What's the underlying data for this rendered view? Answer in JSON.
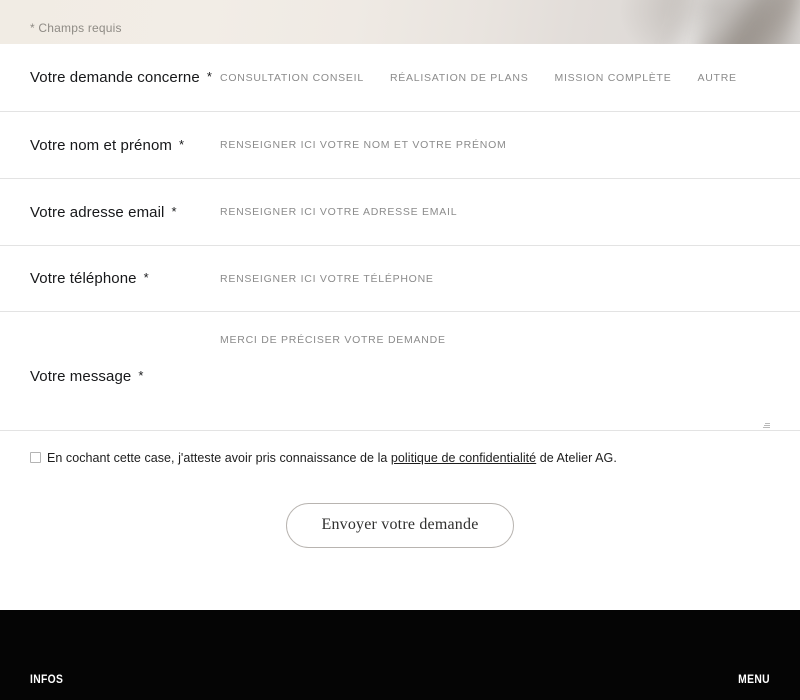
{
  "header": {
    "required_note": "* Champs requis"
  },
  "form": {
    "rows": [
      {
        "label": "Votre demande concerne",
        "required_mark": "*",
        "type": "options",
        "options": [
          "CONSULTATION CONSEIL",
          "RÉALISATION DE PLANS",
          "MISSION COMPLÈTE",
          "AUTRE"
        ]
      },
      {
        "label": "Votre nom et prénom",
        "required_mark": "*",
        "type": "text",
        "placeholder": "RENSEIGNER ICI VOTRE NOM ET VOTRE PRÉNOM",
        "value": ""
      },
      {
        "label": "Votre adresse email",
        "required_mark": "*",
        "type": "email",
        "placeholder": "RENSEIGNER ICI VOTRE ADRESSE EMAIL",
        "value": ""
      },
      {
        "label": "Votre téléphone",
        "required_mark": "*",
        "type": "tel",
        "placeholder": "RENSEIGNER ICI VOTRE TÉLÉPHONE",
        "value": ""
      },
      {
        "label": "Votre message",
        "required_mark": "*",
        "type": "textarea",
        "placeholder": "MERCI DE PRÉCISER VOTRE DEMANDE",
        "value": ""
      }
    ],
    "consent": {
      "checked": false,
      "text_before": "En cochant cette case, j'atteste avoir pris connaissance de la ",
      "link_text": "politique de confidentialité",
      "text_after": " de Atelier AG."
    },
    "submit_label": "Envoyer votre demande"
  },
  "footer": {
    "infos_label": "INFOS",
    "menu_label": "MENU"
  },
  "colors": {
    "page_background": "#ffffff",
    "hero_cream": "#f1ece4",
    "hero_grey": "#dedad7",
    "text_dark": "#17181a",
    "text_muted": "#8b8b8b",
    "divider": "#e3e3e3",
    "footer_background": "#050505",
    "footer_text": "#ffffff",
    "button_border": "#b8b4b0"
  }
}
